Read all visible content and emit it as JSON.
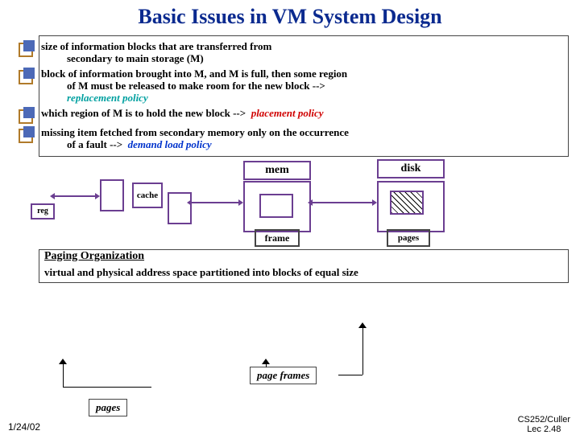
{
  "title": "Basic Issues in VM System Design",
  "b1_l1": "size of information blocks that are transferred from",
  "b1_l2": "secondary to main storage (M)",
  "b2_l1": "block of information brought into M, and M is full, then some region",
  "b2_l2": "of M must be released to make room for the new block -->",
  "b2_l3": "replacement policy",
  "b3_l1": "which region of M is to hold the new block -->",
  "b3_place": "placement policy",
  "b4_l1": "missing item fetched from secondary memory only on the occurrence",
  "b4_l2": "of a fault  -->",
  "b4_dem": "demand load policy",
  "d": {
    "reg": "reg",
    "cache": "cache",
    "mem": "mem",
    "disk": "disk",
    "frame": "frame",
    "pages": "pages"
  },
  "porg": {
    "title": "Paging Organization",
    "line": "virtual and physical address space partitioned into blocks of equal size",
    "pageframes": "page frames",
    "pages": "pages"
  },
  "footer": {
    "date": "1/24/02",
    "r1": "CS252/Culler",
    "r2": "Lec 2.48"
  }
}
